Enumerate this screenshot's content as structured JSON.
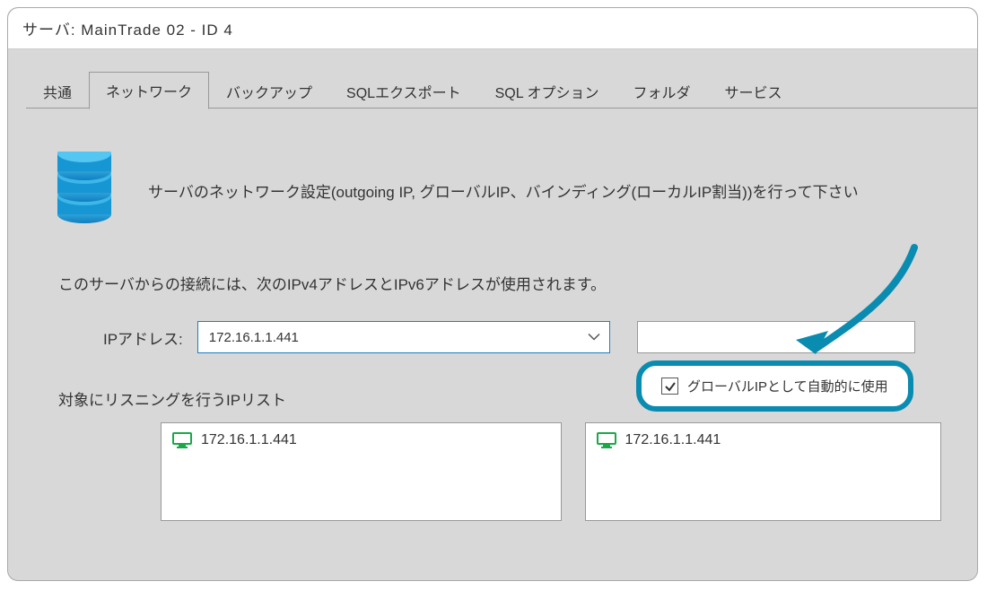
{
  "window": {
    "title": "サーバ: MainTrade 02 - ID  4"
  },
  "tabs": {
    "items": [
      {
        "label": "共通"
      },
      {
        "label": "ネットワーク"
      },
      {
        "label": "バックアップ"
      },
      {
        "label": "SQLエクスポート"
      },
      {
        "label": "SQL オプション"
      },
      {
        "label": "フォルダ"
      },
      {
        "label": "サービス"
      }
    ],
    "activeIndex": 1
  },
  "network": {
    "intro": "サーバのネットワーク設定(outgoing IP, グローバルIP、バインディング(ローカルIP割当))を行って下さい",
    "desc": "このサーバからの接続には、次のIPv4アドレスとIPv6アドレスが使用されます。",
    "ipLabel": "IPアドレス:",
    "ipValue": "172.16.1.1.441",
    "listeningLabel": "対象にリスニングを行うIPリスト",
    "listLeft": [
      {
        "ip": "172.16.1.1.441"
      }
    ],
    "listRight": [
      {
        "ip": "172.16.1.1.441"
      }
    ],
    "autoGlobalLabel": "グローバルIPとして自動的に使用",
    "autoGlobalChecked": true
  },
  "colors": {
    "highlight": "#0a8bb0",
    "selectBorder": "#1e7fc0",
    "serverIcon": "#1e9fd8",
    "monitorIcon": "#1aa84a"
  }
}
